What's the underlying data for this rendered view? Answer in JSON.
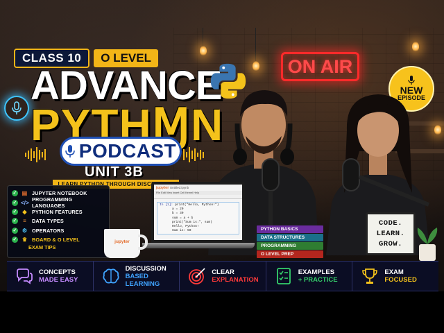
{
  "title": {
    "class_label": "CLASS 10",
    "olevel_label": "O LEVEL",
    "line1": "ADVANCE",
    "line2": "PYTHⱮN",
    "podcast": "PODCAST",
    "unit": "UNIT 3B",
    "tagline": "LEARN PYTHON THROUGH DISCUSSION"
  },
  "on_air": "ON AIR",
  "new_episode": {
    "line1": "NEW",
    "line2": "EPISODE"
  },
  "features": [
    {
      "label": "JUPYTER NOTEBOOK",
      "icon": "notebook-icon"
    },
    {
      "label": "PROGRAMMING LANGUAGES",
      "icon": "code-icon"
    },
    {
      "label": "PYTHON FEATURES",
      "icon": "python-icon"
    },
    {
      "label": "DATA TYPES",
      "icon": "database-icon"
    },
    {
      "label": "OPERATORS",
      "icon": "gear-icon"
    },
    {
      "label": "BOARD & O LEVEL",
      "icon": "trophy-icon"
    }
  ],
  "features_extra": "EXAM TIPS",
  "laptop": {
    "app_name": "jupyter",
    "notebook_name": "Untitled.ipynb",
    "menu": "File  Edit  View  Insert  Cell  Kernel  Help",
    "prompt": "In [1]:",
    "code": [
      "print(\"Hello, Python!\")",
      "a = 20",
      "b = 30",
      "sum = a + b",
      "print(\"Sum is:\", sum)"
    ],
    "output": [
      "Hello, Python!",
      "Sum is: 50"
    ]
  },
  "mug_label": "jupyter",
  "books": [
    "PYTHON BASICS",
    "DATA STRUCTURES",
    "PROGRAMMING LANGUAGES",
    "O LEVEL PREP"
  ],
  "sign": [
    "CODE.",
    "LEARN.",
    "GROW."
  ],
  "bottom_bar": [
    {
      "line1": "CONCEPTS",
      "line2": "MADE EASY",
      "icon": "chat-bubbles-icon",
      "color": "#c58bff"
    },
    {
      "line1": "DISCUSSION",
      "line2": "BASED LEARNING",
      "icon": "brain-icon",
      "color": "#3fa3ff"
    },
    {
      "line1": "CLEAR",
      "line2": "EXPLANATION",
      "icon": "target-icon",
      "color": "#ff3a3a"
    },
    {
      "line1": "EXAMPLES",
      "line2": "+ PRACTICE",
      "icon": "checklist-icon",
      "color": "#35d06b"
    },
    {
      "line1": "EXAM",
      "line2": "FOCUSED",
      "icon": "trophy-icon",
      "color": "#f4c21b"
    }
  ]
}
